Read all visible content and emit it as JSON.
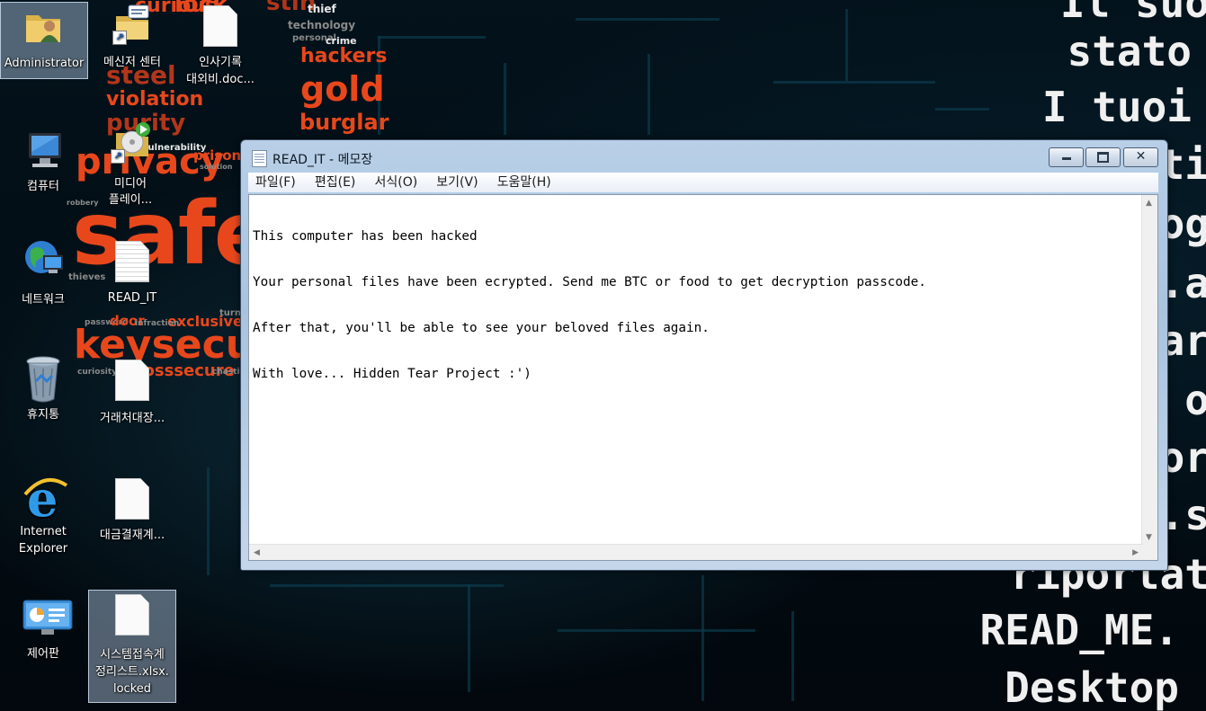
{
  "desktop": {
    "icons": [
      {
        "label": "Administrator",
        "icon": "user-folder-icon"
      },
      {
        "label": "메신저 센터",
        "icon": "messenger-folder-icon"
      },
      {
        "label": "인사기록\n대외비.doc...",
        "icon": "document-icon"
      },
      {
        "label": "컴퓨터",
        "icon": "computer-icon"
      },
      {
        "label": "미디어\n플레이...",
        "icon": "media-player-icon"
      },
      {
        "label": "네트워크",
        "icon": "network-icon"
      },
      {
        "label": "READ_IT",
        "icon": "text-file-icon"
      },
      {
        "label": "휴지통",
        "icon": "recycle-bin-icon"
      },
      {
        "label": "거래처대장...",
        "icon": "document-icon"
      },
      {
        "label": "Internet\nExplorer",
        "icon": "internet-explorer-icon"
      },
      {
        "label": "대금결재계...",
        "icon": "document-icon"
      },
      {
        "label": "제어판",
        "icon": "control-panel-icon"
      },
      {
        "label": "시스템접속계\n정리스트.xlsx.\nlocked",
        "icon": "document-icon"
      }
    ]
  },
  "wallpaper": {
    "words": [
      "curious",
      "technology",
      "personal",
      "crime",
      "hackers",
      "gold",
      "burglar",
      "steel",
      "violation",
      "purity",
      "privacy",
      "vulnerability",
      "prison",
      "solution",
      "safe",
      "thieves",
      "exclusive",
      "password",
      "door",
      "infraction",
      "turn",
      "keysecurit",
      "curiosity",
      "crosssecure",
      "chastity",
      "robbery",
      "thief",
      "lock",
      "stin"
    ],
    "ransom_lines": [
      "Il suo",
      "stato",
      "I tuoi",
      "ti",
      "og",
      ".a",
      "ar",
      "o",
      "or",
      ".s",
      "riportat",
      "READ_ME.",
      "Desktop"
    ]
  },
  "notepad": {
    "title": "READ_IT - 메모장",
    "controls": {
      "minimize": "minimize",
      "maximize": "maximize",
      "close": "close"
    },
    "menu": [
      "파일(F)",
      "편집(E)",
      "서식(O)",
      "보기(V)",
      "도움말(H)"
    ],
    "content": [
      "This computer has been hacked",
      "Your personal files have been ecrypted. Send me BTC or food to get decryption passcode.",
      "After that, you'll be able to see your beloved files again.",
      "With love... Hidden Tear Project :')"
    ]
  },
  "colors": {
    "accent_red": "#e8471c",
    "window_frame": "#b8cfe7"
  }
}
